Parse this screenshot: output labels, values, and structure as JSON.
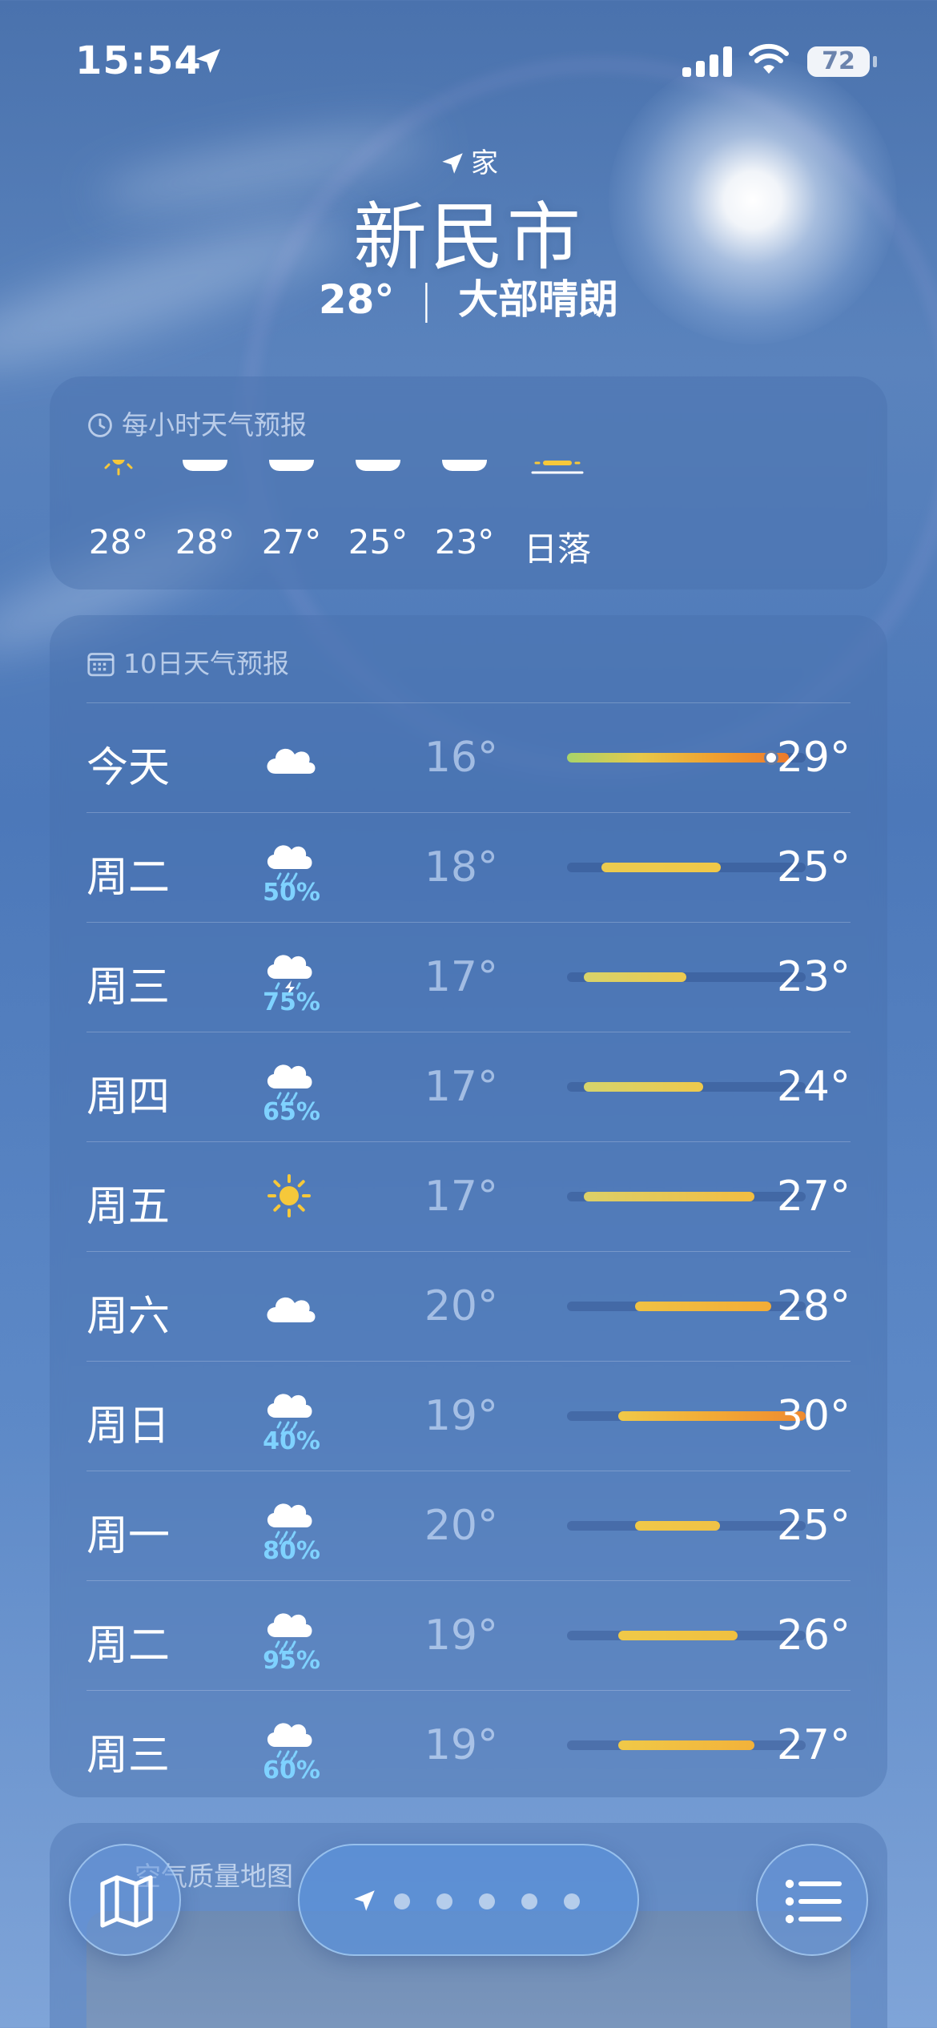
{
  "status_bar": {
    "time": "15:54",
    "battery": "72"
  },
  "header": {
    "location_label": "家",
    "city": "新民市",
    "current_temp": "28°",
    "divider": "|",
    "condition": "大部晴朗"
  },
  "hourly": {
    "title": "每小时天气预报",
    "items": [
      {
        "temp": "28°",
        "icon": "sun-icon"
      },
      {
        "temp": "28°",
        "icon": "cloud-icon"
      },
      {
        "temp": "27°",
        "icon": "cloud-icon"
      },
      {
        "temp": "25°",
        "icon": "cloud-icon"
      },
      {
        "temp": "23°",
        "icon": "cloud-icon"
      },
      {
        "temp": "日落",
        "icon": "sunset-icon"
      }
    ]
  },
  "daily": {
    "title": "10日天气预报",
    "range_min": 16,
    "range_max": 30,
    "current_temp_value": 28,
    "days": [
      {
        "day": "今天",
        "icon": "cloud-icon",
        "precip": "",
        "low": "16°",
        "high": "29°",
        "low_v": 16,
        "high_v": 29,
        "colors": [
          "#a8d46a",
          "#e6c84a",
          "#f0a030",
          "#ec7a2c"
        ]
      },
      {
        "day": "周二",
        "icon": "rain-icon",
        "precip": "50%",
        "low": "18°",
        "high": "25°",
        "low_v": 18,
        "high_v": 25,
        "colors": [
          "#eccb4f",
          "#f0c848"
        ]
      },
      {
        "day": "周三",
        "icon": "thunder-rain-icon",
        "precip": "75%",
        "low": "17°",
        "high": "23°",
        "low_v": 17,
        "high_v": 23,
        "colors": [
          "#d8d36a",
          "#ecc94f"
        ]
      },
      {
        "day": "周四",
        "icon": "rain-icon",
        "precip": "65%",
        "low": "17°",
        "high": "24°",
        "low_v": 17,
        "high_v": 24,
        "colors": [
          "#d6d46c",
          "#eec94c"
        ]
      },
      {
        "day": "周五",
        "icon": "sun-icon",
        "precip": "",
        "low": "17°",
        "high": "27°",
        "low_v": 17,
        "high_v": 27,
        "colors": [
          "#dcd068",
          "#f2bd42"
        ]
      },
      {
        "day": "周六",
        "icon": "cloud-icon",
        "precip": "",
        "low": "20°",
        "high": "28°",
        "low_v": 20,
        "high_v": 28,
        "colors": [
          "#f0c244",
          "#f2ac36"
        ]
      },
      {
        "day": "周日",
        "icon": "rain-icon",
        "precip": "40%",
        "low": "19°",
        "high": "30°",
        "low_v": 19,
        "high_v": 30,
        "colors": [
          "#f0c948",
          "#f2aa36",
          "#ee8a30"
        ]
      },
      {
        "day": "周一",
        "icon": "rain-heavy-icon",
        "precip": "80%",
        "low": "20°",
        "high": "25°",
        "low_v": 20,
        "high_v": 25,
        "colors": [
          "#f0c848",
          "#f0c246"
        ]
      },
      {
        "day": "周二",
        "icon": "rain-heavy-icon",
        "precip": "95%",
        "low": "19°",
        "high": "26°",
        "low_v": 19,
        "high_v": 26,
        "colors": [
          "#f0c948",
          "#f0c040"
        ]
      },
      {
        "day": "周三",
        "icon": "rain-icon",
        "precip": "60%",
        "low": "19°",
        "high": "27°",
        "low_v": 19,
        "high_v": 27,
        "colors": [
          "#f0c948",
          "#f2b23a"
        ]
      }
    ]
  },
  "air_quality": {
    "title": "空气质量地图"
  },
  "bottom_bar": {
    "page_count": 5,
    "active_page": 0
  },
  "colors": {
    "precip": "#7fd2ff",
    "sun": "#f6c83a"
  }
}
